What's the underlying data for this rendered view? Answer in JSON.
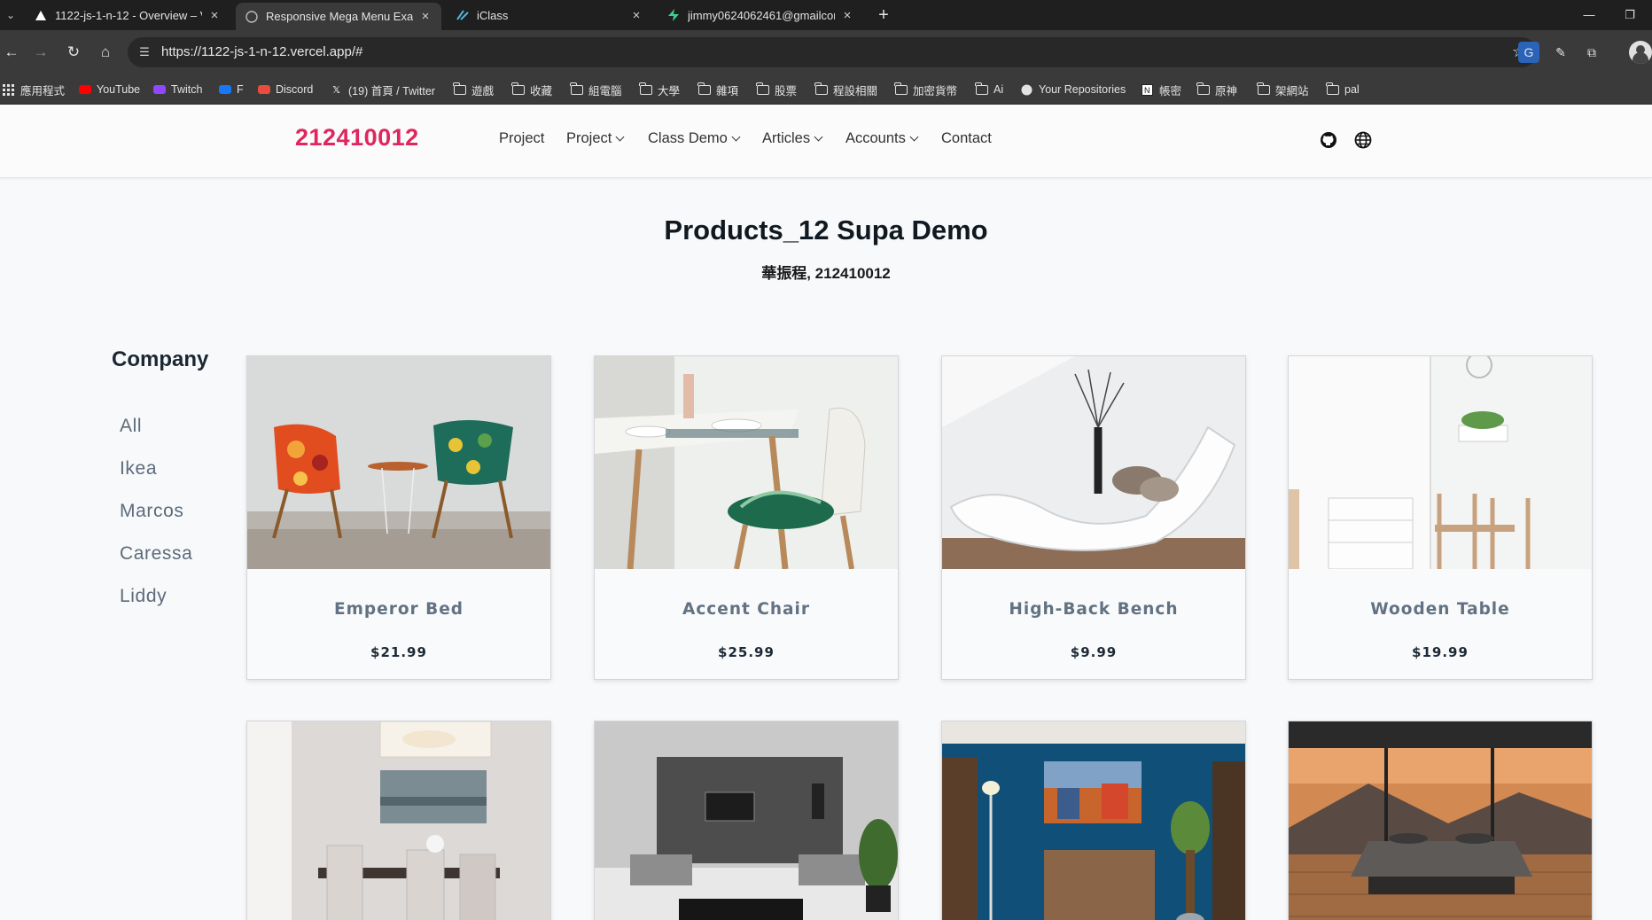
{
  "browser": {
    "tabs": [
      {
        "title": "1122-js-1-n-12 - Overview – V",
        "icon": "vercel-triangle-icon"
      },
      {
        "title": "Responsive Mega Menu Exam",
        "icon": "globe-icon"
      },
      {
        "title": "iClass",
        "icon": "iclass-icon"
      },
      {
        "title": "jimmy0624062461@gmailcor",
        "icon": "supabase-icon"
      }
    ],
    "url": "https://1122-js-1-n-12.vercel.app/#",
    "bookmarks": [
      {
        "label": "應用程式",
        "icon": "apps-grid-icon"
      },
      {
        "label": "YouTube",
        "icon": "youtube-icon"
      },
      {
        "label": "Twitch",
        "icon": "twitch-icon"
      },
      {
        "label": "F",
        "icon": "facebook-icon"
      },
      {
        "label": "Discord",
        "icon": "discord-icon"
      },
      {
        "label": "(19) 首頁 / Twitter",
        "icon": "x-icon"
      },
      {
        "label": "遊戲",
        "icon": "folder-icon"
      },
      {
        "label": "收藏",
        "icon": "folder-icon"
      },
      {
        "label": "組電腦",
        "icon": "folder-icon"
      },
      {
        "label": "大學",
        "icon": "folder-icon"
      },
      {
        "label": "雜項",
        "icon": "folder-icon"
      },
      {
        "label": "股票",
        "icon": "folder-icon"
      },
      {
        "label": "程設相關",
        "icon": "folder-icon"
      },
      {
        "label": "加密貨幣",
        "icon": "folder-icon"
      },
      {
        "label": "Ai",
        "icon": "folder-icon"
      },
      {
        "label": "Your Repositories",
        "icon": "github-icon"
      },
      {
        "label": "帳密",
        "icon": "notion-icon"
      },
      {
        "label": "原神",
        "icon": "folder-icon"
      },
      {
        "label": "架網站",
        "icon": "folder-icon"
      },
      {
        "label": "pal",
        "icon": "folder-icon"
      }
    ]
  },
  "site": {
    "brand": "212410012",
    "nav": [
      {
        "label": "Project",
        "dropdown": false
      },
      {
        "label": "Project",
        "dropdown": true
      },
      {
        "label": "Class Demo",
        "dropdown": true
      },
      {
        "label": "Articles",
        "dropdown": true
      },
      {
        "label": "Accounts",
        "dropdown": true
      },
      {
        "label": "Contact",
        "dropdown": false
      }
    ],
    "nav_icons": [
      "github-icon",
      "globe-icon"
    ],
    "brand_color": "#e0265e"
  },
  "page": {
    "title": "Products_12 Supa Demo",
    "subtitle": "華振程, 212410012"
  },
  "sidebar": {
    "heading": "Company",
    "filters": [
      "All",
      "Ikea",
      "Marcos",
      "Caressa",
      "Liddy"
    ]
  },
  "products": [
    {
      "name": "Emperor Bed",
      "price": "$21.99",
      "image": "two-patterned-chairs-photo"
    },
    {
      "name": "Accent Chair",
      "price": "$25.99",
      "image": "dining-chair-table-photo"
    },
    {
      "name": "High-Back Bench",
      "price": "$9.99",
      "image": "white-lounge-chaise-photo"
    },
    {
      "name": "Wooden Table",
      "price": "$19.99",
      "image": "white-dresser-room-photo"
    },
    {
      "name": "",
      "price": "",
      "image": "dining-room-photo"
    },
    {
      "name": "",
      "price": "",
      "image": "grey-living-room-photo"
    },
    {
      "name": "",
      "price": "",
      "image": "blue-wall-living-room-photo"
    },
    {
      "name": "",
      "price": "",
      "image": "bed-mountain-view-photo"
    }
  ]
}
